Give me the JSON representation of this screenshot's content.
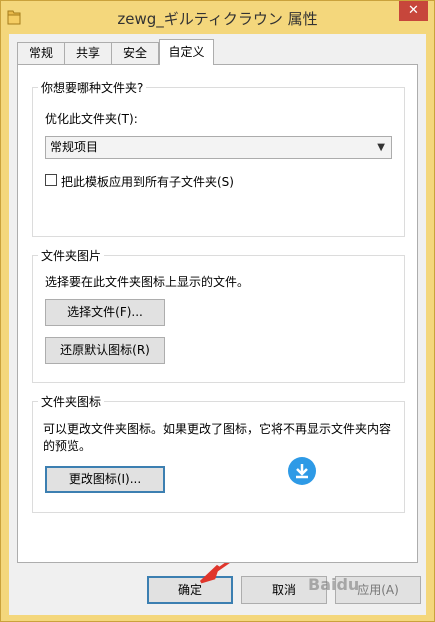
{
  "window": {
    "title": "zewg_ギルティクラウン 属性",
    "close_label": "✕"
  },
  "tabs": [
    {
      "label": "常规"
    },
    {
      "label": "共享"
    },
    {
      "label": "安全"
    },
    {
      "label": "自定义"
    }
  ],
  "group_type": {
    "title": "你想要哪种文件夹?",
    "optimize_label": "优化此文件夹(T):",
    "select_value": "常规项目",
    "checkbox_label": "把此模板应用到所有子文件夹(S)",
    "checkbox_checked": false
  },
  "group_picture": {
    "title": "文件夹图片",
    "description": "选择要在此文件夹图标上显示的文件。",
    "choose_button": "选择文件(F)...",
    "restore_button": "还原默认图标(R)"
  },
  "group_icon": {
    "title": "文件夹图标",
    "description_line1": "可以更改文件夹图标。如果更改了图标，它将不再显示文件夹内容",
    "description_line2": "的预览。",
    "change_button": "更改图标(I)..."
  },
  "footer": {
    "ok": "确定",
    "cancel": "取消",
    "apply": "应用(A)"
  },
  "watermark_text": "Baidu",
  "colors": {
    "title_bar": "#f4d77c",
    "close_button": "#c7463b",
    "annotation_arrow": "#e0362c",
    "download_badge": "#2e9ae6"
  }
}
